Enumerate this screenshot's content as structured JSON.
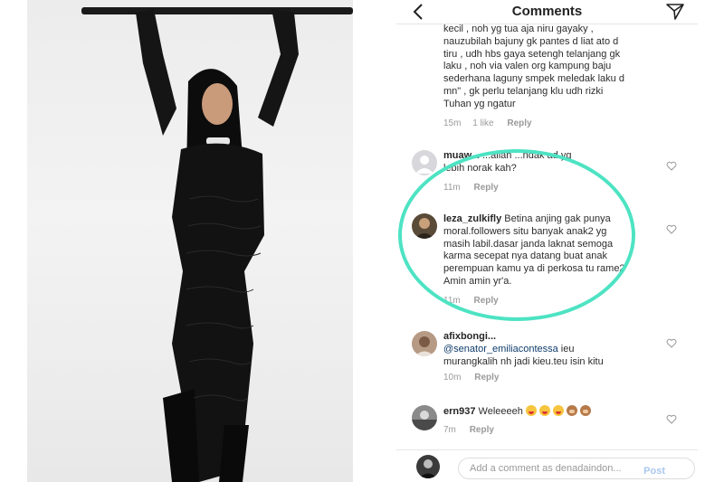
{
  "header": {
    "title": "Comments",
    "back_icon": "chevron-left-icon",
    "send_icon": "paper-plane-icon"
  },
  "comments": [
    {
      "text_lines": [
        "kecil , noh yg tua aja niru gayaky ,",
        "nauzubilah bajuny gk pantes d liat ato d",
        "tiru , udh hbs gaya setengh telanjang gk",
        "laku , noh via valen org kampung baju",
        "sederhana laguny smpek meledak laku d",
        "mn\" , gk perlu telanjang klu udh rizki",
        "Tuhan yg ngatur"
      ],
      "time": "15m",
      "likes": "1 like",
      "reply": "Reply"
    },
    {
      "username": "muaw...",
      "line1": "...allah ...ndak ad yg",
      "line2": "lebih norak kah?",
      "time": "11m",
      "reply": "Reply"
    },
    {
      "username": "leza_zulkifly",
      "line1": "Betina anjing gak punya",
      "lines": [
        "moral.followers situ banyak anak2 yg",
        "masih labil.dasar janda laknat semoga",
        "karma secepat nya datang buat anak",
        "perempuan kamu ya di perkosa tu rame2",
        "Amin amin yr'a."
      ],
      "time": "11m",
      "reply": "Reply"
    },
    {
      "username": "afixbongi...",
      "mention": "@senator_emiliacontessa",
      "line1": "ieu",
      "line2": "murangkalih nh jadi kieu.teu isin kitu",
      "time": "10m",
      "reply": "Reply"
    },
    {
      "username": "ern937",
      "text": "Weleeeeh",
      "time": "7m",
      "reply": "Reply"
    }
  ],
  "composer": {
    "placeholder": "Add a comment as denadaindon...",
    "post_label": "Post"
  },
  "colors": {
    "highlight": "#4de3c3",
    "post_disabled": "#a9c8ee"
  }
}
